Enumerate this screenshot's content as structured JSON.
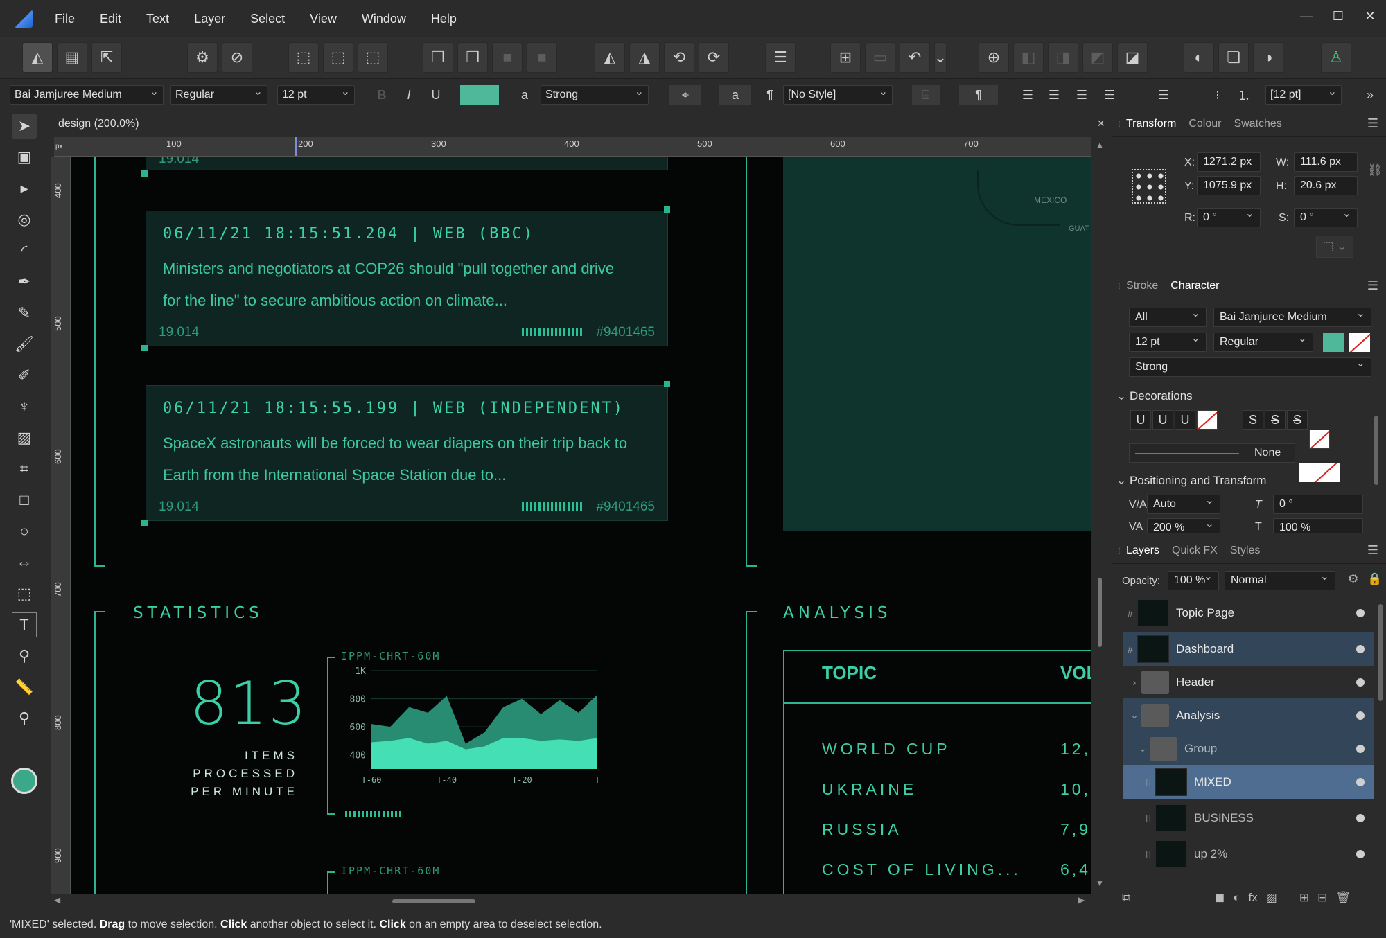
{
  "menubar": {
    "items": [
      "File",
      "Edit",
      "Text",
      "Layer",
      "Select",
      "View",
      "Window",
      "Help"
    ]
  },
  "context_toolbar": {
    "font_family": "Bai Jamjuree Medium",
    "font_style": "Regular",
    "font_size": "12 pt",
    "bold_label": "B",
    "italic_label": "I",
    "underline_label": "U",
    "fill_color": "#4fb89a",
    "char_style_glyph": "a",
    "char_style": "Strong",
    "lowercase_glyph": "a",
    "pilcrow_glyph": "¶",
    "para_style": "[No Style]",
    "leading": "[12 pt]",
    "overflow_glyph": "»"
  },
  "document": {
    "tab_title": "design (200.0%)",
    "close_glyph": "×",
    "ruler_unit": "px",
    "ruler_h_labels": [
      "100",
      "200",
      "300",
      "400",
      "500",
      "600",
      "700"
    ],
    "ruler_v_labels": [
      "400",
      "500",
      "600",
      "700",
      "800",
      "900"
    ]
  },
  "design": {
    "top_remnant_text": "19.014",
    "cards": [
      {
        "title": "06/11/21 18:15:51.204 | WEB (BBC)",
        "body": "Ministers and negotiators at COP26 should \"pull together and drive for the line\" to secure ambitious action on climate...",
        "meta": "19.014",
        "id": "#9401465"
      },
      {
        "title": "06/11/21 18:15:55.199 | WEB (INDEPENDENT)",
        "body": "SpaceX astronauts will be forced to wear diapers on their trip back to Earth from the International Space Station due to...",
        "meta": "19.014",
        "id": "#9401465"
      }
    ],
    "map_labels": [
      "MEXICO",
      "GUAT"
    ],
    "statistics_title": "STATISTICS",
    "big_number": "813",
    "big_sub_line1": "ITEMS PROCESSED",
    "big_sub_line2": "PER MINUTE",
    "chart_code": "IPPM-CHRT-60M",
    "chart_code_2": "IPPM-CHRT-60M",
    "analysis_title": "ANALYSIS",
    "table_headers": [
      "TOPIC",
      "VOL"
    ],
    "table_rows": [
      {
        "topic": "WORLD CUP",
        "vol": "12,"
      },
      {
        "topic": "UKRAINE",
        "vol": "10,"
      },
      {
        "topic": "RUSSIA",
        "vol": "7,9"
      },
      {
        "topic": "COST OF LIVING...",
        "vol": "6,4"
      }
    ],
    "accent": "#3ccfa5"
  },
  "chart_data": {
    "type": "area",
    "title": "IPPM-CHRT-60M",
    "xlabel": "",
    "ylabel": "",
    "x_ticks": [
      "T-60",
      "T-40",
      "T-20",
      "T"
    ],
    "y_ticks": [
      "1K",
      "800",
      "600",
      "400"
    ],
    "ylim": [
      300,
      1000
    ],
    "x": [
      -60,
      -55,
      -50,
      -45,
      -40,
      -35,
      -30,
      -25,
      -20,
      -15,
      -10,
      -5,
      0
    ],
    "series": [
      {
        "values": [
          620,
          600,
          740,
          700,
          820,
          480,
          560,
          740,
          800,
          690,
          790,
          700,
          830
        ]
      },
      {
        "values": [
          490,
          500,
          520,
          480,
          500,
          440,
          460,
          520,
          520,
          500,
          510,
          500,
          520
        ]
      }
    ]
  },
  "transform_panel": {
    "tabs": [
      "Transform",
      "Colour",
      "Swatches"
    ],
    "x_label": "X:",
    "x_value": "1271.2 px",
    "y_label": "Y:",
    "y_value": "1075.9 px",
    "w_label": "W:",
    "w_value": "111.6 px",
    "h_label": "H:",
    "h_value": "20.6 px",
    "r_label": "R:",
    "r_value": "0 °",
    "s_label": "S:",
    "s_value": "0 °"
  },
  "character_panel": {
    "tabs": [
      "Stroke",
      "Character"
    ],
    "scope": "All",
    "font_family": "Bai Jamjuree Medium",
    "font_size": "12 pt",
    "font_style": "Regular",
    "char_style": "Strong",
    "decorations_title": "Decorations",
    "deco_buttons": [
      "U",
      "U",
      "U",
      "S",
      "S",
      "S"
    ],
    "deco_none": "None",
    "positioning_title": "Positioning and Transform",
    "kerning": "Auto",
    "tracking": "200 %",
    "shear": "0 °",
    "scale": "100 %"
  },
  "layers_panel": {
    "tabs": [
      "Layers",
      "Quick FX",
      "Styles"
    ],
    "opacity_label": "Opacity:",
    "opacity_value": "100 %",
    "blend_mode": "Normal",
    "layers": [
      {
        "name": "Topic Page"
      },
      {
        "name": "Dashboard"
      },
      {
        "name": "Header"
      },
      {
        "name": "Analysis"
      },
      {
        "name": "Group"
      },
      {
        "name": "MIXED"
      },
      {
        "name": "BUSINESS"
      },
      {
        "name": "up 2%"
      }
    ]
  },
  "status": {
    "p1": "'MIXED' selected. ",
    "b1": "Drag",
    "p2": " to move selection. ",
    "b2": "Click",
    "p3": " another object to select it. ",
    "b3": "Click",
    "p4": " on an empty area to deselect selection."
  }
}
